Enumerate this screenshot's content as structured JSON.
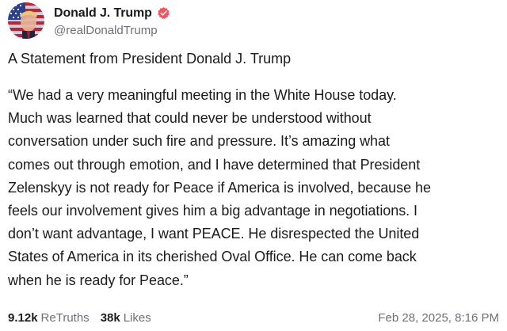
{
  "author": {
    "display_name": "Donald J. Trump",
    "handle": "@realDonaldTrump",
    "verified": true,
    "verified_color": "#ff4f5a",
    "avatar": "avatar-american-flag-portrait"
  },
  "post": {
    "headline": "A Statement from President Donald J. Trump",
    "body_lines": [
      "“We had a very meaningful meeting in the White House today.",
      "Much was learned that could never be understood without",
      "conversation under such fire and pressure. It’s amazing what",
      "comes out through emotion, and I have determined that President",
      "Zelenskyy is not ready for Peace if America is involved, because he",
      "feels our involvement gives him a big advantage in negotiations. I",
      "don’t want advantage, I want PEACE. He disrespected the United",
      "States of America in its cherished Oval Office. He can come back",
      "when he is ready for Peace.”"
    ]
  },
  "stats": {
    "retruths_count": "9.12k",
    "retruths_label": "ReTruths",
    "likes_count": "38k",
    "likes_label": "Likes"
  },
  "timestamp": "Feb 28, 2025, 8:16 PM",
  "colors": {
    "text": "#1b1b1b",
    "muted": "#6f6f78",
    "background": "#ffffff"
  }
}
